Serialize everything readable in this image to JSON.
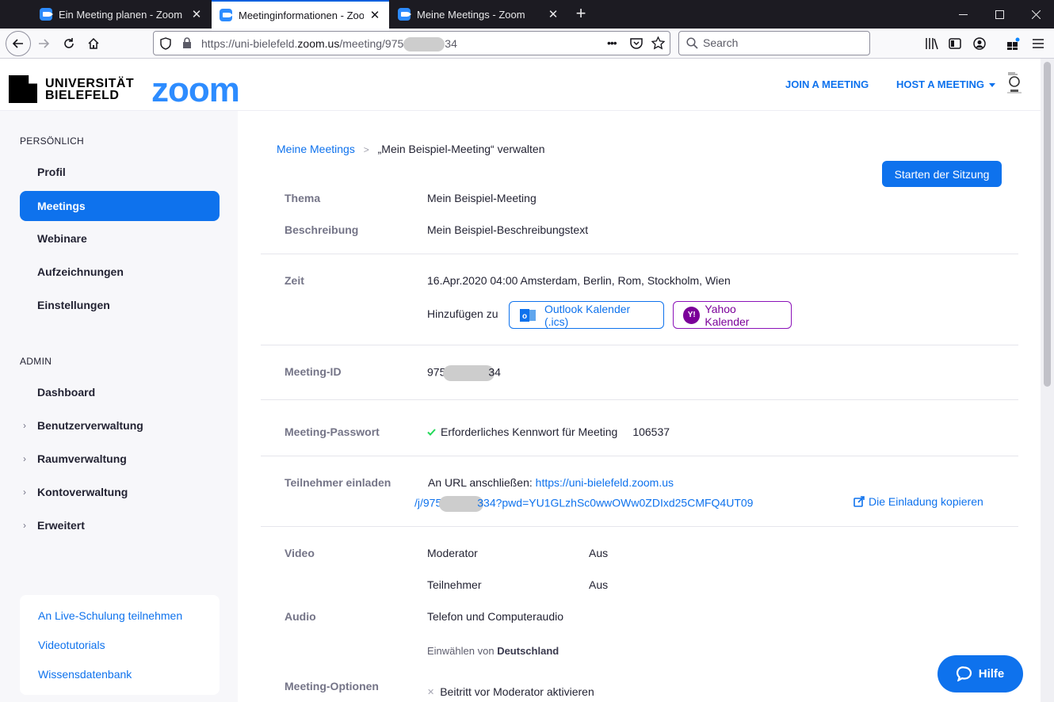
{
  "browser": {
    "tabs": [
      {
        "title": "Ein Meeting planen - Zoom",
        "active": false
      },
      {
        "title": "Meetinginformationen - Zoom",
        "active": true
      },
      {
        "title": "Meine Meetings - Zoom",
        "active": false
      }
    ],
    "url": {
      "prefix": "https://uni-bielefeld.",
      "domain": "zoom.us",
      "path": "/meeting/975",
      "suffix": "34"
    },
    "search_placeholder": "Search",
    "url_menu": "•••"
  },
  "header": {
    "uni_line1": "UNIVERSITÄT",
    "uni_line2": "BIELEFELD",
    "zoom_logo": "zoom",
    "join": "JOIN A MEETING",
    "host": "HOST A MEETING"
  },
  "sidebar": {
    "personal_title": "PERSÖNLICH",
    "personal": [
      "Profil",
      "Meetings",
      "Webinare",
      "Aufzeichnungen",
      "Einstellungen"
    ],
    "active": "Meetings",
    "admin_title": "ADMIN",
    "admin": [
      {
        "label": "Dashboard",
        "expandable": false
      },
      {
        "label": "Benutzerverwaltung",
        "expandable": true
      },
      {
        "label": "Raumverwaltung",
        "expandable": true
      },
      {
        "label": "Kontoverwaltung",
        "expandable": true
      },
      {
        "label": "Erweitert",
        "expandable": true
      }
    ],
    "help_links": [
      "An Live-Schulung teilnehmen",
      "Videotutorials",
      "Wissensdatenbank"
    ]
  },
  "main": {
    "breadcrumb": {
      "link": "Meine Meetings",
      "sep": ">",
      "current": "„Mein Beispiel-Meeting“ verwalten"
    },
    "start_button": "Starten der Sitzung",
    "topic": {
      "label": "Thema",
      "value": "Mein Beispiel-Meeting"
    },
    "description": {
      "label": "Beschreibung",
      "value": "Mein Beispiel-Beschreibungstext"
    },
    "time": {
      "label": "Zeit",
      "value": "16.Apr.2020 04:00 Amsterdam, Berlin, Rom, Stockholm, Wien"
    },
    "add_to": "Hinzufügen zu",
    "outlook": "Outlook Kalender (.ics)",
    "yahoo": "Yahoo Kalender",
    "meeting_id": {
      "label": "Meeting-ID",
      "prefix": "975",
      "suffix": "34"
    },
    "password": {
      "label": "Meeting-Passwort",
      "text": "Erforderliches Kennwort für Meeting",
      "value": "106537"
    },
    "invite": {
      "label": "Teilnehmer einladen",
      "prefix": "An URL anschließen:",
      "url_line1": "https://uni-bielefeld.zoom.us",
      "url_line2_a": "/j/975",
      "url_line2_b": "334?pwd=YU1GLzhSc0wwOWw0ZDIxd25CMFQ4UT09",
      "copy": "Die Einladung kopieren"
    },
    "video": {
      "label": "Video",
      "host_label": "Moderator",
      "host_value": "Aus",
      "participant_label": "Teilnehmer",
      "participant_value": "Aus"
    },
    "audio": {
      "label": "Audio",
      "value": "Telefon und Computeraudio",
      "dial_in_prefix": "Einwählen von",
      "dial_in_country": "Deutschland"
    },
    "options": {
      "label": "Meeting-Optionen",
      "first": "Beitritt vor Moderator aktivieren"
    }
  },
  "help_button": "Hilfe",
  "colors": {
    "accent": "#0e72ed",
    "yahoo": "#7b0099",
    "sidebar_bg": "#f7f7fa"
  }
}
